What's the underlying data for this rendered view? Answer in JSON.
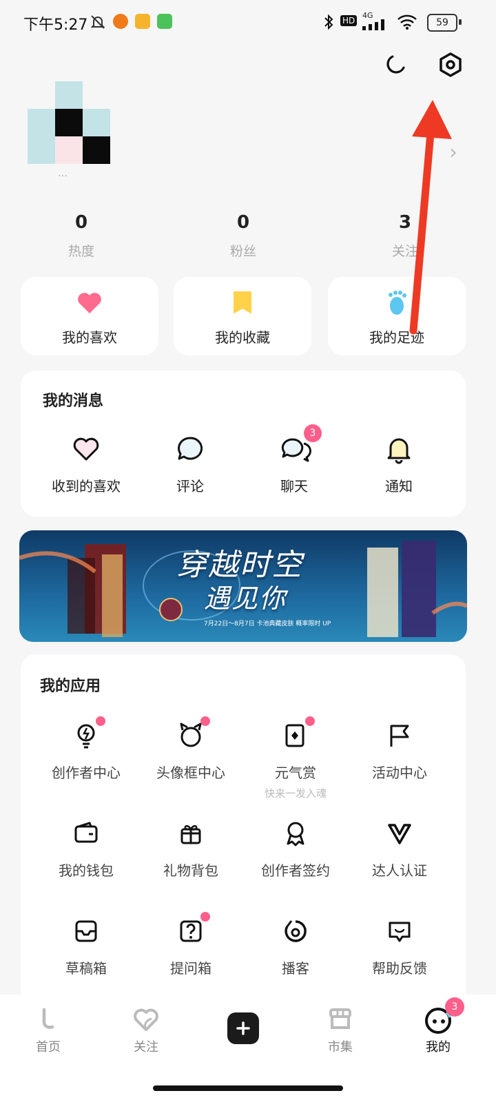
{
  "status_bar": {
    "time": "下午5:27",
    "network": "4G",
    "hd": "HD",
    "battery": "59"
  },
  "profile": {
    "username": "…"
  },
  "stats": [
    {
      "value": "0",
      "label": "热度"
    },
    {
      "value": "0",
      "label": "粉丝"
    },
    {
      "value": "3",
      "label": "关注"
    }
  ],
  "quick_actions": [
    {
      "label": "我的喜欢",
      "icon": "heart-icon",
      "color": "#ff6b8e"
    },
    {
      "label": "我的收藏",
      "icon": "bookmark-icon",
      "color": "#ffd24a"
    },
    {
      "label": "我的足迹",
      "icon": "footprint-icon",
      "color": "#5cc7f0"
    }
  ],
  "messages": {
    "title": "我的消息",
    "items": [
      {
        "label": "收到的喜欢",
        "icon": "heart-outline-icon"
      },
      {
        "label": "评论",
        "icon": "comment-icon"
      },
      {
        "label": "聊天",
        "icon": "chat-icon",
        "badge": "3"
      },
      {
        "label": "通知",
        "icon": "bell-icon"
      }
    ]
  },
  "banner": {
    "title_line1": "穿越时空",
    "title_line2": "遇见你",
    "caption": "7月22日～8月7日 卡池典藏皮肤 概率限时 UP"
  },
  "apps": {
    "title": "我的应用",
    "items": [
      {
        "label": "创作者中心",
        "icon": "bulb-icon",
        "dot": true
      },
      {
        "label": "头像框中心",
        "icon": "avatar-frame-icon",
        "dot": true
      },
      {
        "label": "元气赏",
        "sub": "快来一发入魂",
        "icon": "card-icon",
        "dot": true
      },
      {
        "label": "活动中心",
        "icon": "flag-icon"
      },
      {
        "label": "我的钱包",
        "icon": "wallet-icon"
      },
      {
        "label": "礼物背包",
        "icon": "gift-icon"
      },
      {
        "label": "创作者签约",
        "icon": "award-icon"
      },
      {
        "label": "达人认证",
        "icon": "v-badge-icon"
      },
      {
        "label": "草稿箱",
        "icon": "inbox-icon"
      },
      {
        "label": "提问箱",
        "icon": "question-box-icon",
        "dot": true
      },
      {
        "label": "播客",
        "icon": "podcast-icon"
      },
      {
        "label": "帮助反馈",
        "icon": "feedback-icon"
      }
    ]
  },
  "tabbar": {
    "items": [
      {
        "label": "首页",
        "icon": "home-icon"
      },
      {
        "label": "关注",
        "icon": "follow-heart-icon"
      },
      {
        "label": "",
        "icon": "plus-icon"
      },
      {
        "label": "市集",
        "icon": "shop-icon"
      },
      {
        "label": "我的",
        "icon": "me-icon",
        "badge": "3"
      }
    ]
  },
  "colors": {
    "accent_pink": "#ff5f8a",
    "arrow_red": "#ee3a24"
  }
}
